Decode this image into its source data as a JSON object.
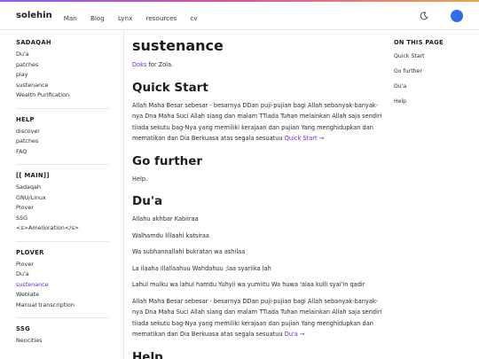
{
  "header": {
    "brand": "solehin",
    "nav": [
      "Man",
      "Blog",
      "Lynx",
      "resources",
      "cv"
    ]
  },
  "sidebar": {
    "sections": [
      {
        "title": "SADAQAH",
        "items": [
          {
            "label": "Du'a"
          },
          {
            "label": "patches"
          },
          {
            "label": "play"
          },
          {
            "label": "sustenance"
          },
          {
            "label": "Wealth Purification"
          }
        ]
      },
      {
        "title": "HELP",
        "items": [
          {
            "label": "discover"
          },
          {
            "label": "patches"
          },
          {
            "label": "FAQ"
          }
        ]
      },
      {
        "title": "[[ MAIN]]",
        "items": [
          {
            "label": "Sadaqah"
          },
          {
            "label": "GNU/Linux"
          },
          {
            "label": "Plover"
          },
          {
            "label": "SSG"
          },
          {
            "label": "<s>Amelioration</s>"
          }
        ]
      },
      {
        "title": "PLOVER",
        "items": [
          {
            "label": "Plover"
          },
          {
            "label": "Du'a"
          },
          {
            "label": "sustenance",
            "active": true
          },
          {
            "label": "Weblate"
          },
          {
            "label": "Manual transcription"
          }
        ]
      },
      {
        "title": "SSG",
        "items": [
          {
            "label": "Neocities"
          }
        ]
      }
    ]
  },
  "main": {
    "title": "sustenance",
    "intro_link": "Doks",
    "intro_rest": " for Zola.",
    "quick_start": {
      "heading": "Quick Start",
      "text": "Allah Maha Besar sebesar - besarnya DDan puji-pujian bagi Allah sebanyak-banyak-nya Dna Maha Suci Allah siang dan malam TTiada Tuhan melainkan Allah saja sendiri tiiada sekutu bag-Nya yang memiliki kerajaan dan pujian Yang menghidupkan dan mematikan dan Dia Berkuasa atas segala sesuatuu ",
      "link": "Quick Start →"
    },
    "further": {
      "heading": "Go further",
      "text": "Help."
    },
    "dua": {
      "heading": "Du'a",
      "lines": [
        "Allahu akhbar Kabiiraa",
        "Walhamdu lillaahi katsiraa",
        "Wa subhannallahi bukratan wa ashilaa",
        "La ilaaha illallaahuu Wahdahuu ;laa syariika lah",
        "Lahul mulku wa lahul hamdu Yuhyii wa yumiitu Wa huwa 'alaa kulli syai'in qadir"
      ],
      "text": "Allah Maha Besar sebesar - besarnya DDan puji-pujian bagi Allah sebanyak-banyak-nya Dna Maha Suci Allah siang dan malam TTiada Tuhan melainkan Allah saja sendiri tiiada sekutu bag-Nya yang memiliki kerajaan dan pujian Yang menghidupkan dan mematikan dan Dia Berkuasa atas segala sesuatuu ",
      "link": "Du'a →"
    },
    "help_heading": "Help"
  },
  "toc": {
    "title": "ON THIS PAGE",
    "items": [
      "Quick Start",
      "Go further",
      "Du'a",
      "Help"
    ]
  },
  "icons": {
    "theme": "moon-icon",
    "chat": "chat-bubble-icon"
  },
  "colors": {
    "accent": "#6b2bd6",
    "chat": "#2f6fe6"
  }
}
